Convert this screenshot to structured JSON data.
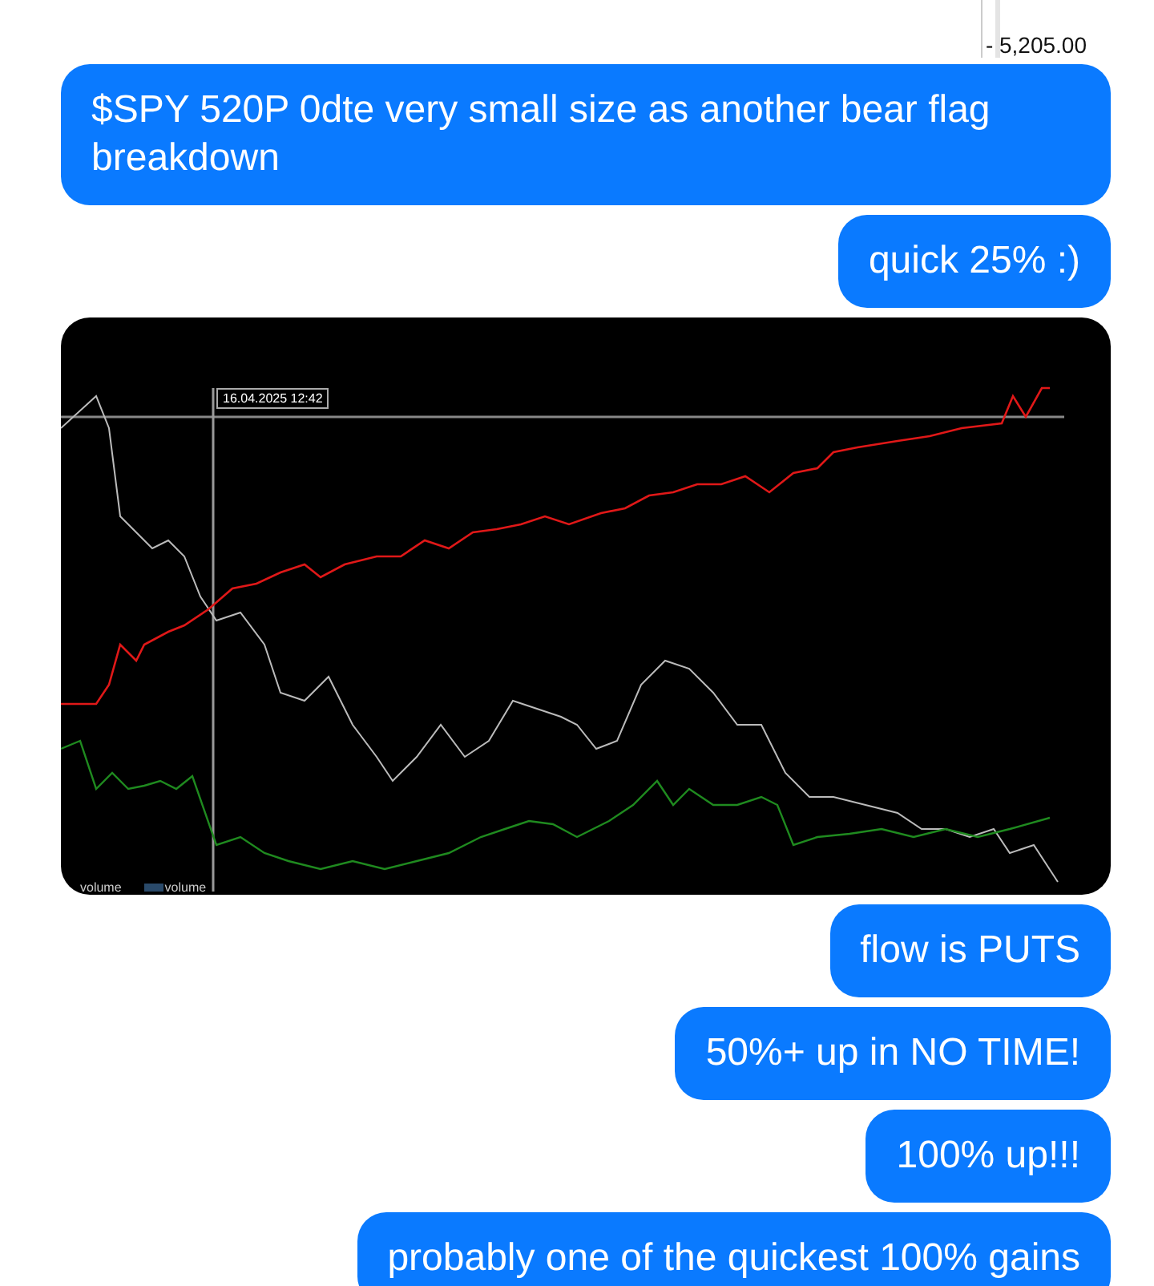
{
  "price_label": "- 5,205.00",
  "messages": [
    {
      "kind": "text",
      "text": "$SPY 520P 0dte very small size as another bear flag breakdown"
    },
    {
      "kind": "text",
      "text": "quick 25% :)"
    },
    {
      "kind": "chart",
      "tooltip": "16.04.2025 12:42",
      "legend": [
        "volume",
        "volume"
      ]
    },
    {
      "kind": "text",
      "text": "flow is PUTS"
    },
    {
      "kind": "text",
      "text": "50%+ up in NO TIME!"
    },
    {
      "kind": "text",
      "text": "100% up!!!"
    },
    {
      "kind": "text",
      "text": "probably one of the quickest 100% gains"
    }
  ]
}
